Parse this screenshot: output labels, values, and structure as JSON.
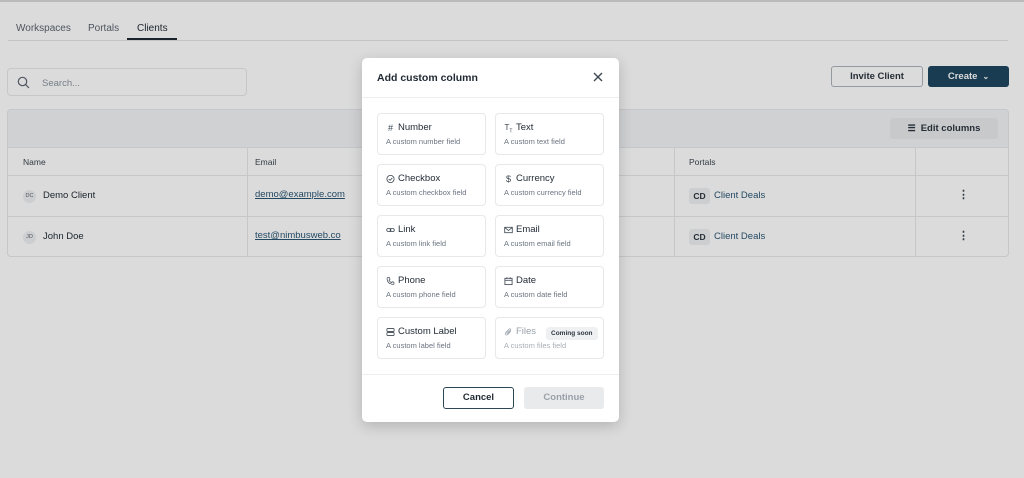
{
  "tabs": [
    {
      "label": "Workspaces",
      "active": false
    },
    {
      "label": "Portals",
      "active": false
    },
    {
      "label": "Clients",
      "active": true
    }
  ],
  "search": {
    "placeholder": "Search..."
  },
  "actions": {
    "invite_label": "Invite Client",
    "create_label": "Create"
  },
  "table": {
    "edit_columns_label": "Edit columns",
    "columns": [
      "Name",
      "Email",
      "Portals"
    ],
    "rows": [
      {
        "initials": "DC",
        "name": "Demo Client",
        "email": "demo@example.com",
        "portal_badge": "CD",
        "portal_name": "Client Deals"
      },
      {
        "initials": "JD",
        "name": "John Doe",
        "email": "test@nimbusweb.co",
        "portal_badge": "CD",
        "portal_name": "Client Deals"
      }
    ]
  },
  "modal": {
    "title": "Add custom column",
    "fields": [
      {
        "title": "Number",
        "desc": "A custom number field",
        "icon": "hash-icon"
      },
      {
        "title": "Text",
        "desc": "A custom text field",
        "icon": "text-icon"
      },
      {
        "title": "Checkbox",
        "desc": "A custom checkbox field",
        "icon": "check-circle-icon"
      },
      {
        "title": "Currency",
        "desc": "A custom currency field",
        "icon": "dollar-icon"
      },
      {
        "title": "Link",
        "desc": "A custom link field",
        "icon": "link-icon"
      },
      {
        "title": "Email",
        "desc": "A custom email field",
        "icon": "mail-icon"
      },
      {
        "title": "Phone",
        "desc": "A custom phone field",
        "icon": "phone-icon"
      },
      {
        "title": "Date",
        "desc": "A custom date field",
        "icon": "calendar-icon"
      },
      {
        "title": "Custom Label",
        "desc": "A custom label field",
        "icon": "label-icon"
      },
      {
        "title": "Files",
        "desc": "A custom files field",
        "icon": "paperclip-icon",
        "badge": "Coming soon"
      }
    ],
    "cancel_label": "Cancel",
    "continue_label": "Continue"
  },
  "colors": {
    "primary": "#1e4660",
    "link": "#2a5674",
    "overlay": "rgba(0,0,0,0.14)"
  }
}
